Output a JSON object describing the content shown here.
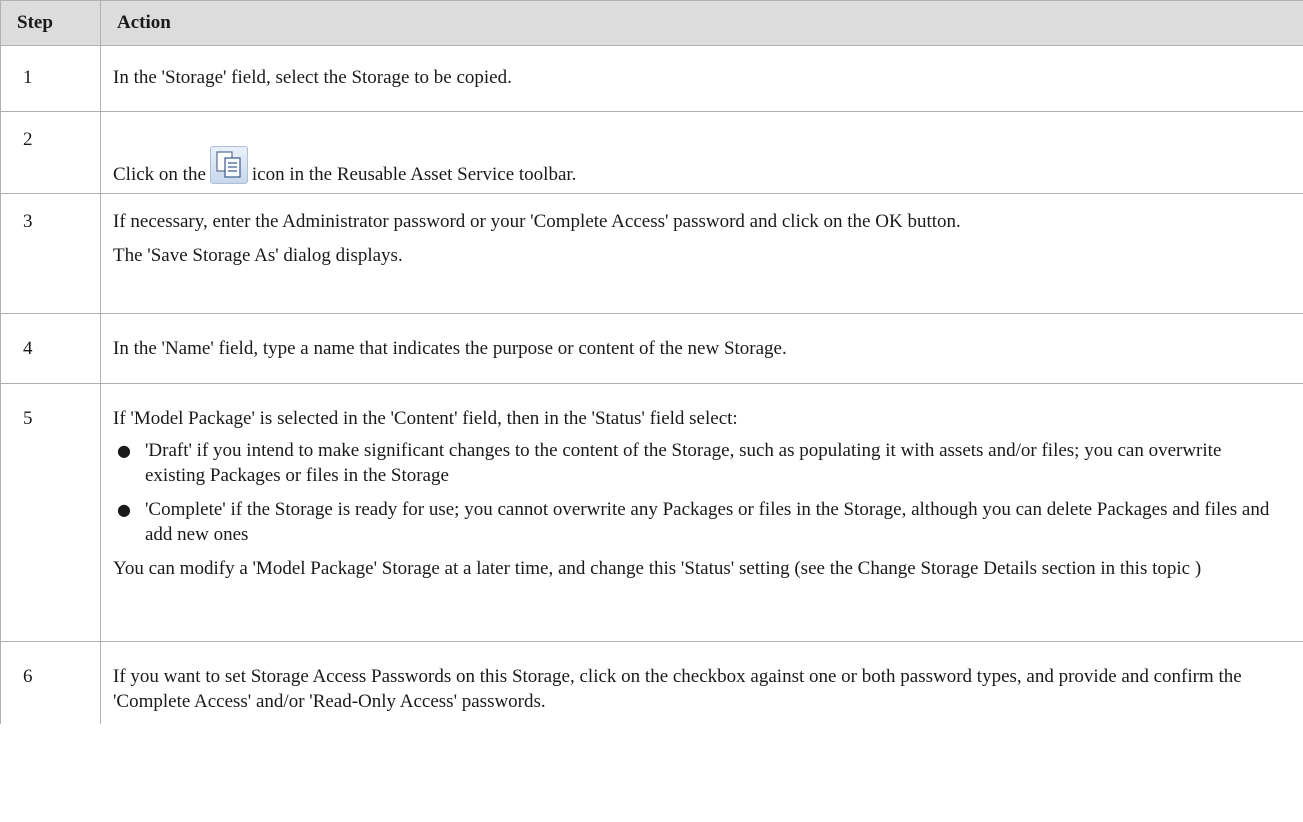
{
  "table": {
    "header": {
      "step": "Step",
      "action": "Action"
    },
    "rows": {
      "r1": {
        "step": "1",
        "text": "In the 'Storage' field, select the Storage to be copied."
      },
      "r2": {
        "step": "2",
        "before": "Click on the",
        "icon": "copy-storage-icon",
        "after": "icon in the Reusable Asset Service toolbar."
      },
      "r3": {
        "step": "3",
        "p1": "If necessary, enter the Administrator password or your 'Complete Access' password and click on the OK button.",
        "p2": "The 'Save Storage As' dialog displays."
      },
      "r4": {
        "step": "4",
        "text": "In the 'Name' field, type a name that indicates the purpose or content of the new Storage."
      },
      "r5": {
        "step": "5",
        "intro": "If 'Model Package' is selected in the 'Content' field, then in the 'Status' field select:",
        "bullets": [
          "'Draft' if you intend to make significant changes to the content of the Storage, such as populating it with assets and/or files; you can overwrite existing Packages or files in the Storage",
          "'Complete' if the Storage is ready for use; you cannot overwrite any Packages or files in the Storage, although you can delete Packages and files and add new ones"
        ],
        "outro": "You can modify a 'Model Package' Storage at a later time, and change this 'Status' setting (see the Change Storage Details section in this topic )"
      },
      "r6": {
        "step": "6",
        "text": "If you want to set Storage Access Passwords on this Storage, click on the checkbox against one or both password types, and provide and confirm the 'Complete Access' and/or 'Read-Only Access' passwords."
      }
    }
  }
}
